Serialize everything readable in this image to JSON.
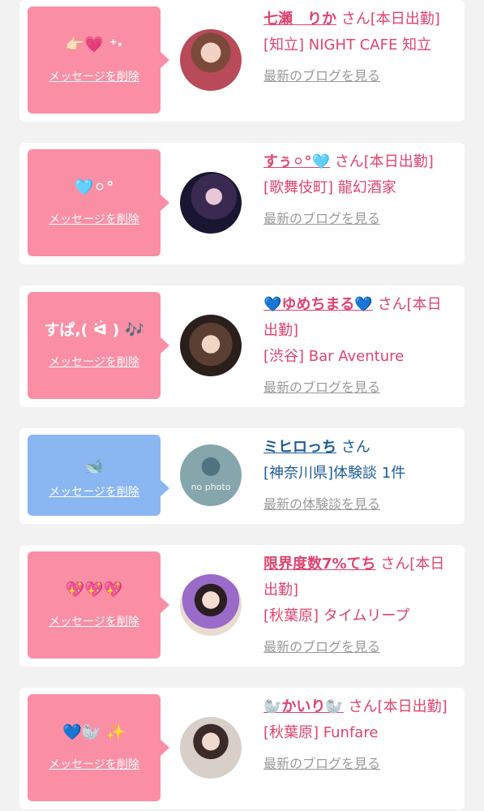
{
  "colors": {
    "pink_bubble": "#fa8ea5",
    "blue_bubble": "#8ab6f2",
    "pink_text": "#e0436d",
    "blue_text": "#1d5b99",
    "link_gray": "#999999"
  },
  "delete_label": "メッセージを削除",
  "san_label": "さん",
  "entries": [
    {
      "message": "👉🏻💗 ⁺‧",
      "name": "七瀬　りか",
      "san_suffix": "さん[本日出勤]",
      "shop": "[知立] NIGHT CAFE 知立",
      "link": "最新のブログを見る",
      "theme": "pink"
    },
    {
      "message": "🩵⚪︎°",
      "name": "すぅ⚪︎°🩵",
      "san_suffix": "さん[本日出勤]",
      "shop": "[歌舞伎町] 龍幻酒家",
      "link": "最新のブログを見る",
      "theme": "pink"
    },
    {
      "message": "すぱ,( ᐛ ) 🎶",
      "name": "💙ゆめちまる💙",
      "san_suffix": "さん[本日出勤]",
      "shop": "[渋谷] Bar Aventure",
      "link": "最新のブログを見る",
      "theme": "pink"
    },
    {
      "message": "🐋",
      "name": "ミヒロっち",
      "san_suffix": "さん",
      "shop": "[神奈川県]体験談 1件",
      "link": "最新の体験談を見る",
      "theme": "blue",
      "no_photo": "no photo"
    },
    {
      "message": "💖💖💖",
      "name": "限界度数7%てち",
      "san_suffix": "さん[本日出勤]",
      "shop": "[秋葉原] タイムリープ",
      "link": "最新のブログを見る",
      "theme": "pink"
    },
    {
      "message": "💙🦭 ✨",
      "name": "🦭かいり🦭",
      "san_suffix": "さん[本日出勤]",
      "shop": "[秋葉原] Funfare",
      "link": "最新のブログを見る",
      "theme": "pink"
    }
  ]
}
